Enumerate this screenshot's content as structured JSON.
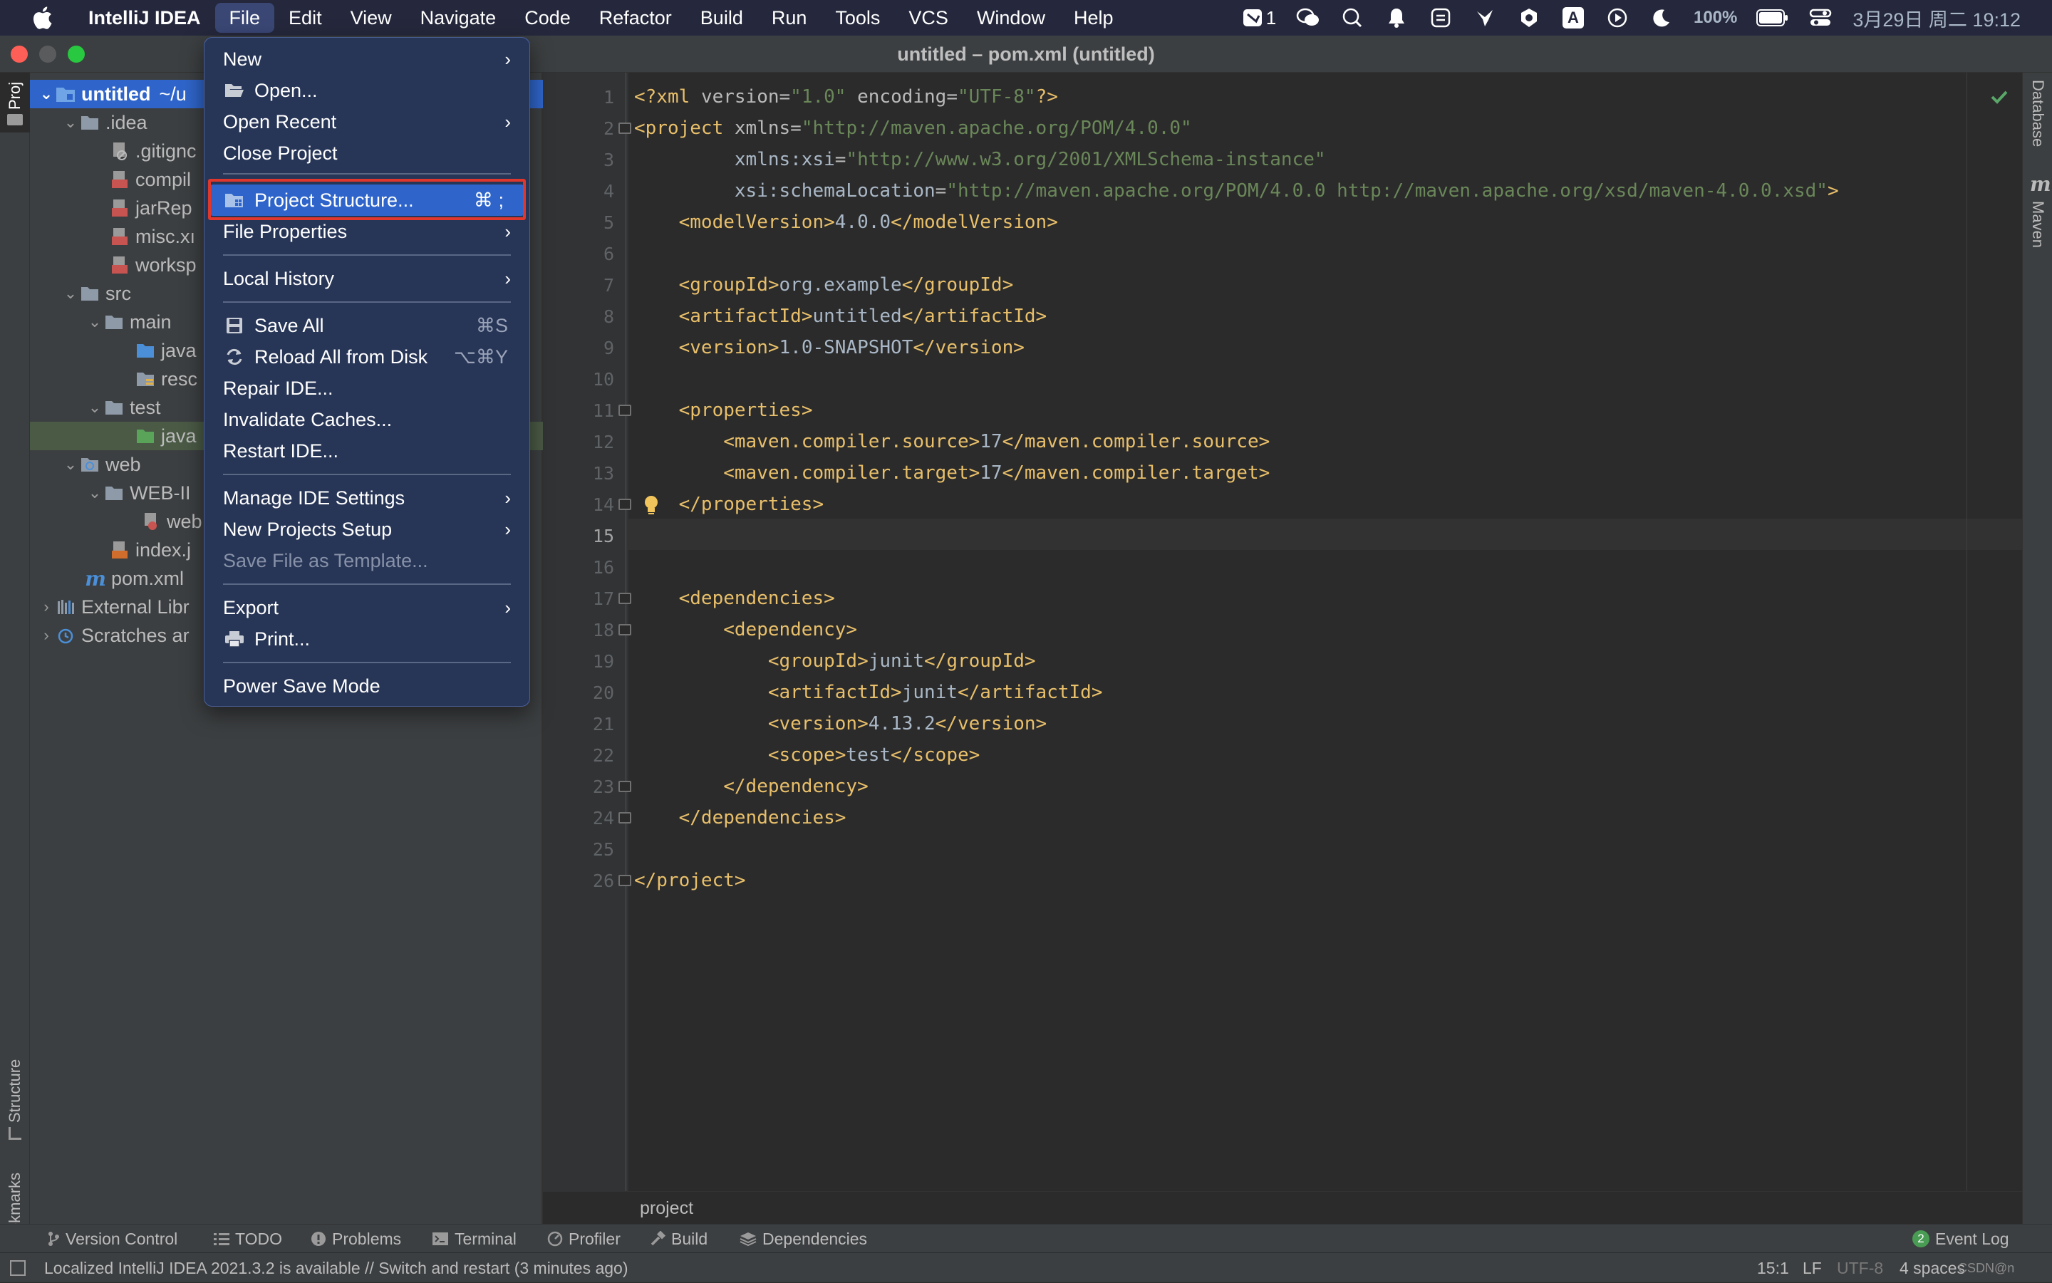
{
  "menubar": {
    "app_name": "IntelliJ IDEA",
    "menus": [
      "File",
      "Edit",
      "View",
      "Navigate",
      "Code",
      "Refactor",
      "Build",
      "Run",
      "Tools",
      "VCS",
      "Window",
      "Help"
    ],
    "active_menu": "File",
    "tray_badge": "1",
    "battery": "100%",
    "datetime": "3月29日 周二  19:12",
    "input_method": "A"
  },
  "window": {
    "title": "untitled – pom.xml (untitled)"
  },
  "left_stripe": {
    "project": "Proj",
    "structure": "Structure",
    "bookmarks": "Bookmarks"
  },
  "right_stripe": {
    "database": "Database",
    "maven": "Maven",
    "maven_logo": "m"
  },
  "tree": {
    "root": "untitled",
    "root_path": "~/u",
    "items": [
      ".idea",
      ".gitignc",
      "compil",
      "jarRep",
      "misc.xı",
      "worksp",
      "src",
      "main",
      "java",
      "resc",
      "test",
      "java",
      "web",
      "WEB-II",
      "web",
      "index.j",
      "pom.xml",
      "External Libr",
      "Scratches ar"
    ]
  },
  "file_menu": {
    "items": [
      {
        "label": "New",
        "arrow": true
      },
      {
        "label": "Open..."
      },
      {
        "label": "Open Recent",
        "arrow": true
      },
      {
        "label": "Close Project"
      },
      {
        "label": "Project Structure...",
        "shortcut": "⌘ ;"
      },
      {
        "label": "File Properties",
        "arrow": true
      },
      {
        "label": "Local History",
        "arrow": true
      },
      {
        "label": "Save All",
        "shortcut": "⌘S"
      },
      {
        "label": "Reload All from Disk",
        "shortcut": "⌥⌘Y"
      },
      {
        "label": "Repair IDE..."
      },
      {
        "label": "Invalidate Caches..."
      },
      {
        "label": "Restart IDE..."
      },
      {
        "label": "Manage IDE Settings",
        "arrow": true
      },
      {
        "label": "New Projects Setup",
        "arrow": true
      },
      {
        "label": "Save File as Template..."
      },
      {
        "label": "Export",
        "arrow": true
      },
      {
        "label": "Print..."
      },
      {
        "label": "Power Save Mode"
      }
    ]
  },
  "editor": {
    "line_numbers": [
      "1",
      "2",
      "3",
      "4",
      "5",
      "6",
      "7",
      "8",
      "9",
      "10",
      "11",
      "12",
      "13",
      "14",
      "15",
      "16",
      "17",
      "18",
      "19",
      "20",
      "21",
      "22",
      "23",
      "24",
      "25",
      "26"
    ],
    "lines": [
      "<?xml version=\"1.0\" encoding=\"UTF-8\"?>",
      "<project xmlns=\"http://maven.apache.org/POM/4.0.0\"",
      "         xmlns:xsi=\"http://www.w3.org/2001/XMLSchema-instance\"",
      "         xsi:schemaLocation=\"http://maven.apache.org/POM/4.0.0 http://maven.apache.org/xsd/maven-4.0.0.xsd\">",
      "    <modelVersion>4.0.0</modelVersion>",
      "",
      "    <groupId>org.example</groupId>",
      "    <artifactId>untitled</artifactId>",
      "    <version>1.0-SNAPSHOT</version>",
      "",
      "    <properties>",
      "        <maven.compiler.source>17</maven.compiler.source>",
      "        <maven.compiler.target>17</maven.compiler.target>",
      "    </properties>",
      "",
      "",
      "    <dependencies>",
      "        <dependency>",
      "            <groupId>junit</groupId>",
      "            <artifactId>junit</artifactId>",
      "            <version>4.13.2</version>",
      "            <scope>test</scope>",
      "        </dependency>",
      "    </dependencies>",
      "",
      "</project>"
    ],
    "breadcrumb": "project"
  },
  "bottom_tools": [
    "Version Control",
    "TODO",
    "Problems",
    "Terminal",
    "Profiler",
    "Build",
    "Dependencies"
  ],
  "event_log": {
    "label": "Event Log",
    "count": "2"
  },
  "status": {
    "message": "Localized IntelliJ IDEA 2021.3.2 is available // Switch and restart (3 minutes ago)",
    "position": "15:1",
    "line_sep": "LF",
    "encoding": "UTF-8",
    "indent": "4 spaces",
    "watermark": "CSDN@n"
  }
}
